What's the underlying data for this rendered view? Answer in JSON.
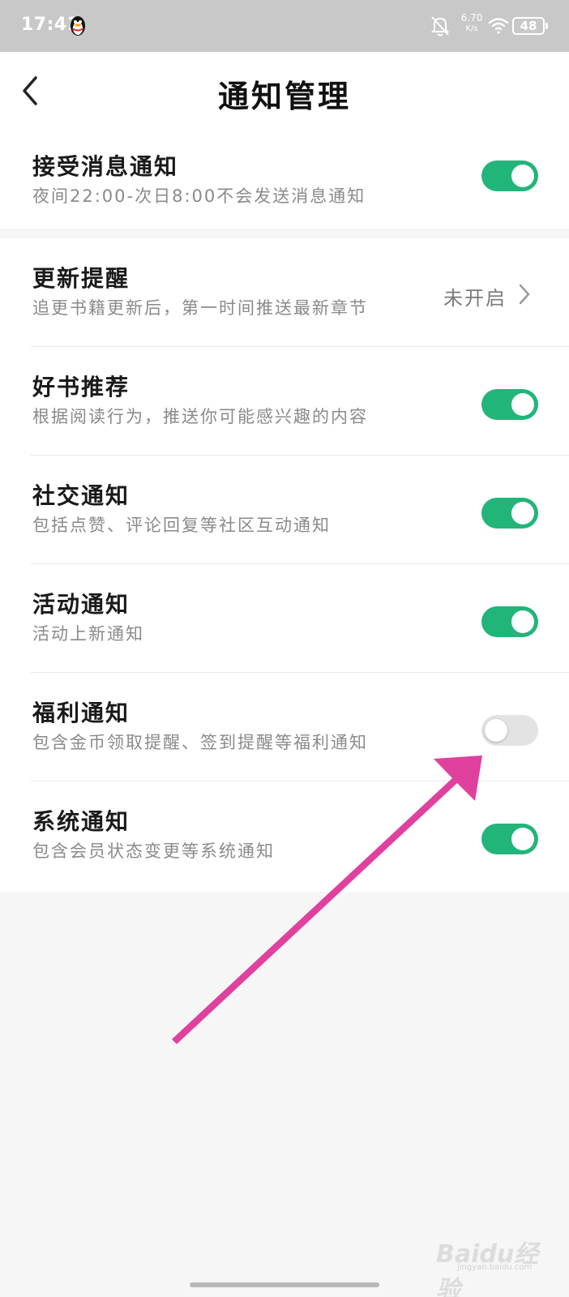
{
  "status_bar": {
    "time": "17:41",
    "net_speed_value": "6.70",
    "net_speed_unit": "K/s",
    "battery": "48"
  },
  "header": {
    "title": "通知管理"
  },
  "sections": [
    {
      "rows": [
        {
          "label": "接受消息通知",
          "desc": "夜间22:00-次日8:00不会发送消息通知",
          "control": "toggle",
          "on": true
        }
      ]
    },
    {
      "rows": [
        {
          "label": "更新提醒",
          "desc": "追更书籍更新后，第一时间推送最新章节",
          "control": "link",
          "value": "未开启"
        },
        {
          "label": "好书推荐",
          "desc": "根据阅读行为，推送你可能感兴趣的内容",
          "control": "toggle",
          "on": true
        },
        {
          "label": "社交通知",
          "desc": "包括点赞、评论回复等社区互动通知",
          "control": "toggle",
          "on": true
        },
        {
          "label": "活动通知",
          "desc": "活动上新通知",
          "control": "toggle",
          "on": true
        },
        {
          "label": "福利通知",
          "desc": "包含金币领取提醒、签到提醒等福利通知",
          "control": "toggle",
          "on": false
        },
        {
          "label": "系统通知",
          "desc": "包含会员状态变更等系统通知",
          "control": "toggle",
          "on": true
        }
      ]
    }
  ],
  "colors": {
    "toggle_on": "#22b57a",
    "toggle_off": "#e3e3e3",
    "annotation_arrow": "#e0409e",
    "status_bar_bg": "#c8c8c8"
  },
  "watermark": {
    "text": "Baidu经验",
    "sub": "jingyan.baidu.com"
  }
}
